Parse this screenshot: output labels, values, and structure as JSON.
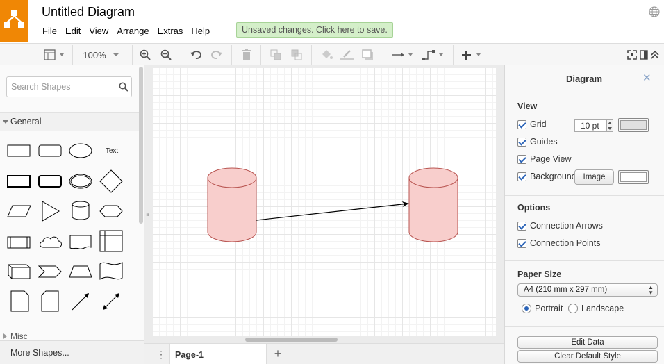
{
  "app": {
    "title": "Untitled Diagram",
    "brand_color": "#f08705",
    "save_banner": "Unsaved changes. Click here to save.",
    "menu": [
      "File",
      "Edit",
      "View",
      "Arrange",
      "Extras",
      "Help"
    ]
  },
  "toolbar": {
    "zoom": "100%",
    "icons": [
      "page-view-icon",
      "zoom-in-icon",
      "zoom-out-icon",
      "undo-icon",
      "redo-icon",
      "delete-icon",
      "to-front-icon",
      "to-back-icon",
      "fill-color-icon",
      "line-color-icon",
      "shadow-icon",
      "connection-icon",
      "waypoints-icon",
      "insert-icon",
      "fullscreen-icon",
      "format-panel-icon",
      "collapse-icon"
    ]
  },
  "sidebar": {
    "search_placeholder": "Search Shapes",
    "general_label": "General",
    "text_shape_label": "Text",
    "misc_label": "Misc",
    "more_shapes": "More Shapes..."
  },
  "diagram": {
    "shapes": [
      {
        "type": "cylinder",
        "fill": "#f8cecc",
        "stroke": "#b85450"
      },
      {
        "type": "cylinder",
        "fill": "#f8cecc",
        "stroke": "#b85450"
      }
    ],
    "edges": [
      {
        "from": 0,
        "to": 1,
        "arrow": "classic"
      }
    ]
  },
  "pages": {
    "tabs": [
      "Page-1"
    ],
    "active": "Page-1"
  },
  "format_panel": {
    "title": "Diagram",
    "view": {
      "title": "View",
      "grid_label": "Grid",
      "grid_size": "10 pt",
      "guides_label": "Guides",
      "page_view_label": "Page View",
      "background_label": "Background",
      "image_button": "Image",
      "grid_color": "#e0e0e0",
      "background_color": "#ffffff"
    },
    "options": {
      "title": "Options",
      "connection_arrows": "Connection Arrows",
      "connection_points": "Connection Points"
    },
    "paper": {
      "title": "Paper Size",
      "size": "A4 (210 mm x 297 mm)",
      "portrait": "Portrait",
      "landscape": "Landscape",
      "orientation": "portrait"
    },
    "buttons": {
      "edit_data": "Edit Data",
      "clear_default_style": "Clear Default Style"
    }
  }
}
